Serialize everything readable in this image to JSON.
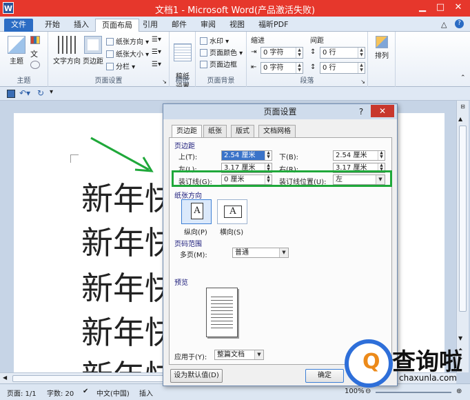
{
  "window": {
    "app_icon": "W",
    "title": "文档1 - Microsoft Word(产品激活失败)",
    "minimize": "▁",
    "restore": "□",
    "close": "✕"
  },
  "ribbon_tabs": [
    {
      "label": "文件",
      "state": "file"
    },
    {
      "label": "开始"
    },
    {
      "label": "插入"
    },
    {
      "label": "页面布局",
      "state": "active"
    },
    {
      "label": "引用"
    },
    {
      "label": "邮件"
    },
    {
      "label": "审阅"
    },
    {
      "label": "视图"
    },
    {
      "label": "福昕PDF"
    }
  ],
  "ribbon": {
    "theme_group": {
      "label": "主题",
      "theme_btn": "主题"
    },
    "page_setup_group": {
      "label": "页面设置",
      "text_direction": "文字方向",
      "margins": "页边距",
      "orientation": "纸张方向",
      "size": "纸张大小",
      "columns": "分栏"
    },
    "draft_group": {
      "label": "稿纸",
      "draft_btn": "稿纸\n设置"
    },
    "background_group": {
      "label": "页面背景",
      "watermark": "水印",
      "page_color": "页面颜色",
      "page_borders": "页面边框"
    },
    "paragraph_group": {
      "label": "段落",
      "indent_title": "缩进",
      "spacing_title": "间距",
      "indent_left_value": "0 字符",
      "indent_right_value": "0 字符",
      "spacing_before_value": "0 行",
      "spacing_after_value": "0 行"
    },
    "arrange_group": {
      "arrange_btn": "排列"
    }
  },
  "document": {
    "lines": [
      "新年快",
      "新年快",
      "新年快",
      "新年快",
      "新年快"
    ]
  },
  "dialog": {
    "title": "页面设置",
    "help": "?",
    "close": "✕",
    "tabs": [
      "页边距",
      "纸张",
      "版式",
      "文档网格"
    ],
    "margins_section": "页边距",
    "top_label": "上(T):",
    "top_value": "2.54 厘米",
    "bottom_label": "下(B):",
    "bottom_value": "2.54 厘米",
    "left_label": "左(L):",
    "left_value": "3.17 厘米",
    "right_label": "右(R):",
    "right_value": "3.17 厘米",
    "gutter_label": "装订线(G):",
    "gutter_value": "0 厘米",
    "gutter_pos_label": "装订线位置(U):",
    "gutter_pos_value": "左",
    "orientation_section": "纸张方向",
    "portrait": "纵向(P)",
    "landscape": "横向(S)",
    "pages_section": "页码范围",
    "multiple_pages_label": "多页(M):",
    "multiple_pages_value": "普通",
    "preview_section": "预览",
    "apply_to_label": "应用于(Y):",
    "apply_to_value": "整篇文档",
    "set_default": "设为默认值(D)",
    "ok": "确定"
  },
  "status_bar": {
    "page": "页面: 1/1",
    "words": "字数: 20",
    "language": "中文(中国)",
    "mode": "插入",
    "zoom": "100%"
  },
  "watermark": {
    "brand": "查询啦",
    "url": "chaxunla.com"
  },
  "colors": {
    "titlebar": "#e6372c",
    "file_tab": "#2b6cc4",
    "highlight_box": "#1fa83a",
    "arrow": "#1fa83a"
  }
}
